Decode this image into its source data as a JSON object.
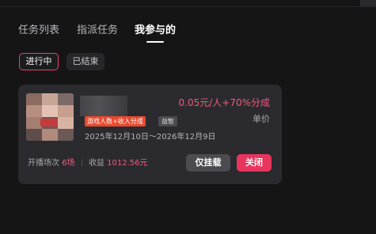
{
  "tabs": [
    {
      "label": "任务列表",
      "active": false
    },
    {
      "label": "指派任务",
      "active": false
    },
    {
      "label": "我参与的",
      "active": true
    }
  ],
  "filters": [
    {
      "label": "进行中",
      "active": true
    },
    {
      "label": "已结束",
      "active": false
    }
  ],
  "card": {
    "tags": {
      "primary": "游戏人数+收入分成",
      "secondary": "益智"
    },
    "price": "0.05元/人+70%分成",
    "price_label": "单价",
    "date_range": "2025年12月10日～2026年12月9日",
    "stats": {
      "sessions_label": "开播场次",
      "sessions_value": "6场",
      "revenue_label": "收益",
      "revenue_value": "1012.56元"
    },
    "buttons": {
      "hang": "仅挂载",
      "close": "关闭"
    }
  },
  "colors": {
    "accent": "#e8355e",
    "price_text": "#f05a7e",
    "background": "#151516",
    "card_background": "#2b2b2f"
  }
}
